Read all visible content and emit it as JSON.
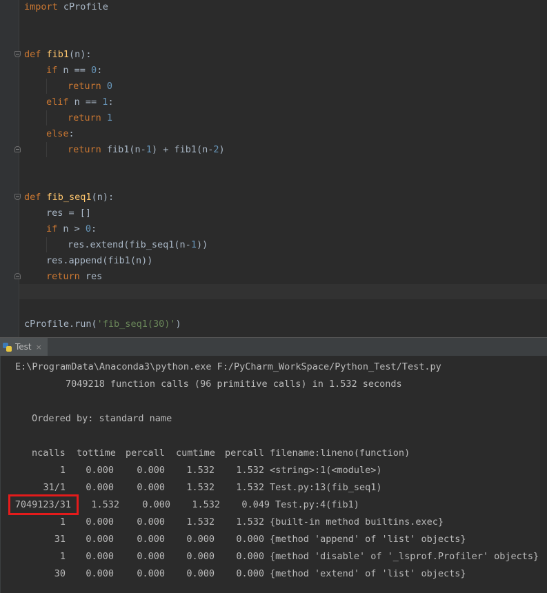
{
  "editor": {
    "lines": [
      [
        {
          "t": "import",
          "c": "kw"
        },
        {
          "t": " cProfile"
        }
      ],
      [
        {
          "t": "def",
          "c": "kw"
        },
        {
          "t": " "
        },
        {
          "t": "fib1",
          "c": "fn"
        },
        {
          "t": "(n):"
        }
      ],
      [
        {
          "t": "if",
          "c": "kw"
        },
        {
          "t": " n == "
        },
        {
          "t": "0",
          "c": "num"
        },
        {
          "t": ":"
        }
      ],
      [
        {
          "t": "return",
          "c": "kw"
        },
        {
          "t": " "
        },
        {
          "t": "0",
          "c": "num"
        }
      ],
      [
        {
          "t": "elif",
          "c": "kw"
        },
        {
          "t": " n == "
        },
        {
          "t": "1",
          "c": "num"
        },
        {
          "t": ":"
        }
      ],
      [
        {
          "t": "return",
          "c": "kw"
        },
        {
          "t": " "
        },
        {
          "t": "1",
          "c": "num"
        }
      ],
      [
        {
          "t": "else",
          "c": "kw"
        },
        {
          "t": ":"
        }
      ],
      [
        {
          "t": "return",
          "c": "kw"
        },
        {
          "t": " fib1(n-"
        },
        {
          "t": "1",
          "c": "num"
        },
        {
          "t": ") + fib1(n-"
        },
        {
          "t": "2",
          "c": "num"
        },
        {
          "t": ")"
        }
      ],
      [
        {
          "t": "def",
          "c": "kw"
        },
        {
          "t": " "
        },
        {
          "t": "fib_seq1",
          "c": "fn"
        },
        {
          "t": "(n):"
        }
      ],
      [
        {
          "t": "res = []"
        }
      ],
      [
        {
          "t": "if",
          "c": "kw"
        },
        {
          "t": " n > "
        },
        {
          "t": "0",
          "c": "num"
        },
        {
          "t": ":"
        }
      ],
      [
        {
          "t": "res.extend(fib_seq1(n-"
        },
        {
          "t": "1",
          "c": "num"
        },
        {
          "t": "))"
        }
      ],
      [
        {
          "t": "res.append(fib1(n))"
        }
      ],
      [
        {
          "t": "return",
          "c": "kw"
        },
        {
          "t": " res"
        }
      ],
      [
        {
          "t": "cProfile.run("
        },
        {
          "t": "'fib_seq1(30)'",
          "c": "str"
        },
        {
          "t": ")"
        }
      ]
    ]
  },
  "run_tab": {
    "label": "Test",
    "close": "×"
  },
  "console": {
    "command": "E:\\ProgramData\\Anaconda3\\python.exe F:/PyCharm_WorkSpace/Python_Test/Test.py",
    "summary": "7049218 function calls (96 primitive calls) in 1.532 seconds",
    "ordered_by": "Ordered by: standard name",
    "header": {
      "ncalls": "ncalls",
      "tottime": "tottime",
      "percall": "percall",
      "cumtime": "cumtime",
      "percall2": "percall",
      "filename": "filename:lineno(function)"
    },
    "rows": [
      {
        "ncalls": "1",
        "tottime": "0.000",
        "percall": "0.000",
        "cumtime": "1.532",
        "percall2": "1.532",
        "filename": "<string>:1(<module>)"
      },
      {
        "ncalls": "31/1",
        "tottime": "0.000",
        "percall": "0.000",
        "cumtime": "1.532",
        "percall2": "1.532",
        "filename": "Test.py:13(fib_seq1)"
      },
      {
        "ncalls": "7049123/31",
        "tottime": "1.532",
        "percall": "0.000",
        "cumtime": "1.532",
        "percall2": "0.049",
        "filename": "Test.py:4(fib1)"
      },
      {
        "ncalls": "1",
        "tottime": "0.000",
        "percall": "0.000",
        "cumtime": "1.532",
        "percall2": "1.532",
        "filename": "{built-in method builtins.exec}"
      },
      {
        "ncalls": "31",
        "tottime": "0.000",
        "percall": "0.000",
        "cumtime": "0.000",
        "percall2": "0.000",
        "filename": "{method 'append' of 'list' objects}"
      },
      {
        "ncalls": "1",
        "tottime": "0.000",
        "percall": "0.000",
        "cumtime": "0.000",
        "percall2": "0.000",
        "filename": "{method 'disable' of '_lsprof.Profiler' objects}"
      },
      {
        "ncalls": "30",
        "tottime": "0.000",
        "percall": "0.000",
        "cumtime": "0.000",
        "percall2": "0.000",
        "filename": "{method 'extend' of 'list' objects}"
      }
    ]
  },
  "colors": {
    "keyword": "#cc7832",
    "number": "#6897bb",
    "function": "#ffc66d",
    "string": "#6a8759",
    "text": "#a9b7c6",
    "highlight_box": "#e41b1b"
  }
}
